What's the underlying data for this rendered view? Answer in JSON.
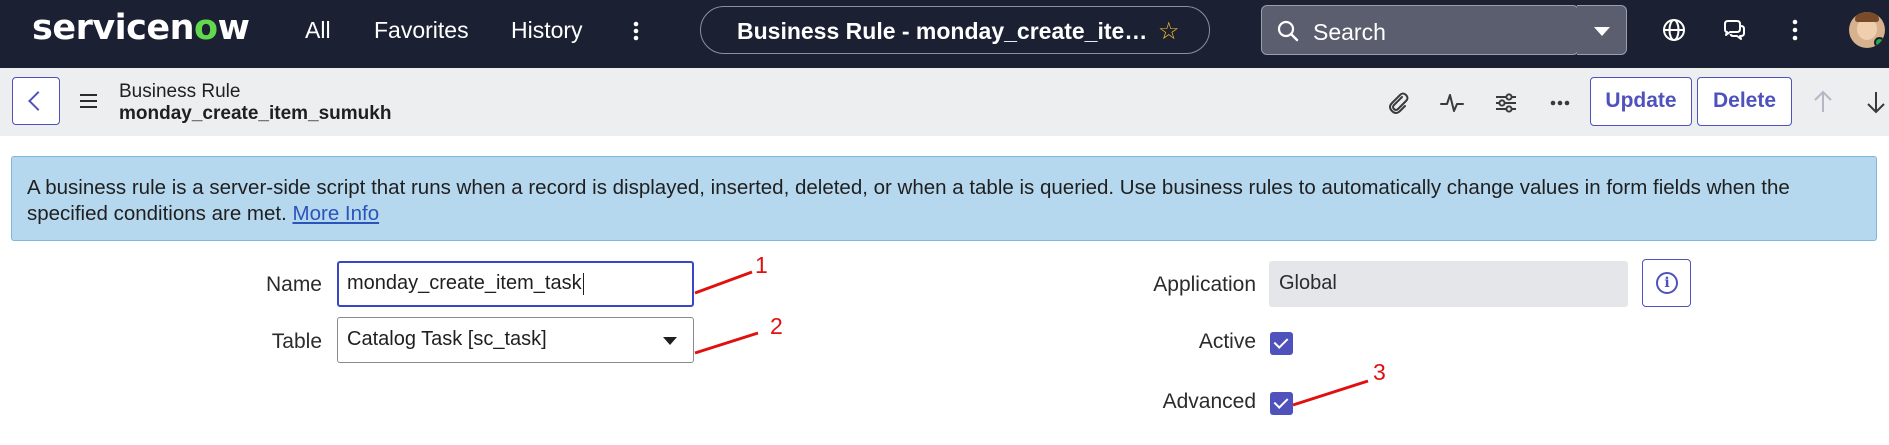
{
  "topbar": {
    "logo_prefix": "servicen",
    "logo_o": "o",
    "logo_suffix": "w",
    "nav": [
      "All",
      "Favorites",
      "History"
    ],
    "record_title": "Business Rule - monday_create_item_sumukh",
    "search_placeholder": "Search",
    "icons": [
      "more-vertical-icon",
      "star-icon",
      "search-icon",
      "globe-icon",
      "chat-icon",
      "more-vertical-icon",
      "user-avatar"
    ]
  },
  "formbar": {
    "record_type": "Business Rule",
    "record_name": "monday_create_item_sumukh",
    "icons": [
      "back-icon",
      "hamburger-icon",
      "attachment-icon",
      "activity-icon",
      "settings-sliders-icon",
      "more-horizontal-icon",
      "arrow-up-icon",
      "arrow-down-icon"
    ],
    "update_label": "Update",
    "delete_label": "Delete"
  },
  "banner": {
    "text": "A business rule is a server-side script that runs when a record is displayed, inserted, deleted, or when a table is queried. Use business rules to automatically change values in form fields when the specified conditions are met.",
    "link": "More Info"
  },
  "form": {
    "name_label": "Name",
    "name_value": "monday_create_item_task",
    "table_label": "Table",
    "table_value": "Catalog Task [sc_task]",
    "application_label": "Application",
    "application_value": "Global",
    "active_label": "Active",
    "active_checked": true,
    "advanced_label": "Advanced",
    "advanced_checked": true
  },
  "annotations": [
    "1",
    "2",
    "3"
  ],
  "colors": {
    "topbar_bg": "#1b2032",
    "accent": "#4f52bd",
    "banner_bg": "#b6d8ee",
    "annotation": "#e01010",
    "logo_green": "#62d84e"
  }
}
